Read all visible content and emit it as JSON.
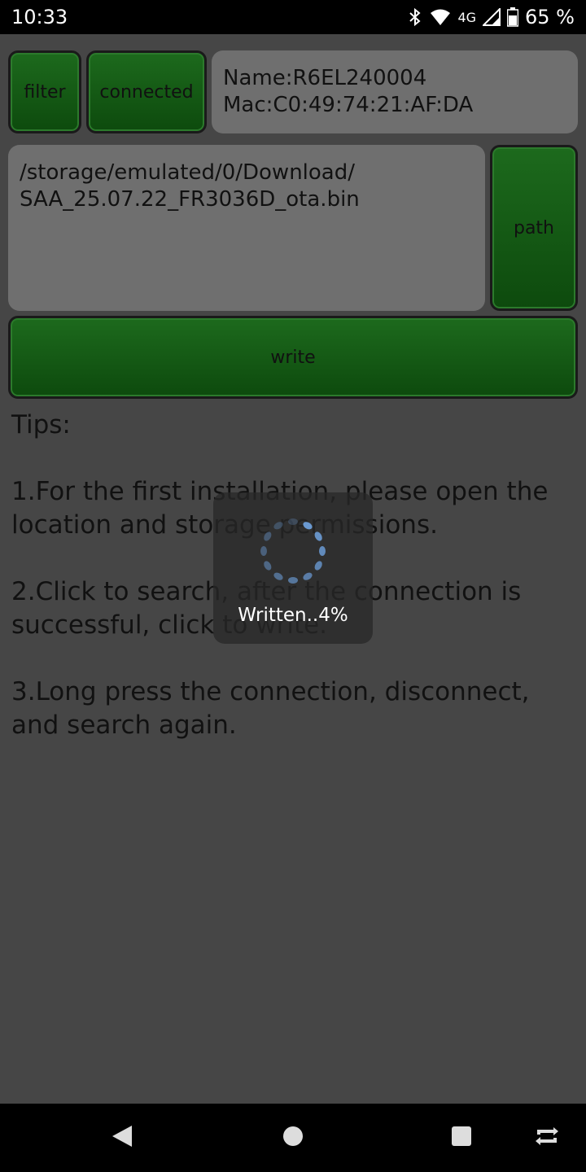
{
  "status_bar": {
    "time": "10:33",
    "network": "4G",
    "battery": "65 %"
  },
  "buttons": {
    "filter": "filter",
    "connected": "connected",
    "path": "path",
    "write": "write"
  },
  "device": {
    "name": "Name:R6EL240004",
    "mac": "Mac:C0:49:74:21:AF:DA"
  },
  "file": {
    "path_line1": "/storage/emulated/0/Download/",
    "path_line2": "SAA_25.07.22_FR3036D_ota.bin"
  },
  "tips": {
    "heading": "Tips:",
    "tip1_line1": "1.For the first installation, please open the",
    "tip1_line2": "location and storage permissions.",
    "tip2_line1": "2.Click to search, after the connection is",
    "tip2_line2": "successful, click to write.",
    "tip3_line1": "3.Long press the connection, disconnect,",
    "tip3_line2": "and search again."
  },
  "progress": {
    "text": "Written..4%",
    "percent": 4
  }
}
